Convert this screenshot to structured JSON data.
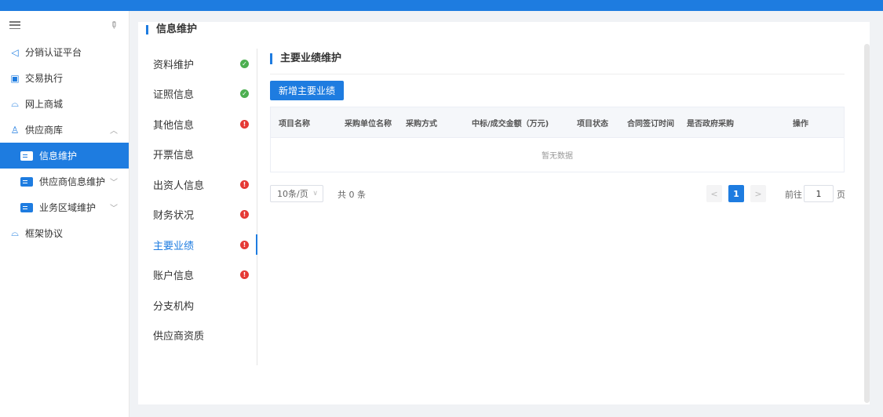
{
  "sidebar": {
    "items": [
      {
        "label": "分销认证平台",
        "icon": "speaker-icon"
      },
      {
        "label": "交易执行",
        "icon": "clipboard-icon"
      },
      {
        "label": "网上商城",
        "icon": "store-icon"
      },
      {
        "label": "供应商库",
        "icon": "user-icon"
      },
      {
        "label": "框架协议",
        "icon": "store-icon"
      }
    ],
    "subitems": [
      {
        "label": "信息维护"
      },
      {
        "label": "供应商信息维护"
      },
      {
        "label": "业务区域维护"
      }
    ]
  },
  "card": {
    "title": "信息维护"
  },
  "steps": [
    {
      "label": "资料维护",
      "status": "ok"
    },
    {
      "label": "证照信息",
      "status": "ok"
    },
    {
      "label": "其他信息",
      "status": "error"
    },
    {
      "label": "开票信息",
      "status": ""
    },
    {
      "label": "出资人信息",
      "status": "error"
    },
    {
      "label": "财务状况",
      "status": "error"
    },
    {
      "label": "主要业绩",
      "status": "error"
    },
    {
      "label": "账户信息",
      "status": "error"
    },
    {
      "label": "分支机构",
      "status": ""
    },
    {
      "label": "供应商资质",
      "status": ""
    }
  ],
  "section": {
    "title": "主要业绩维护",
    "add_button": "新增主要业绩",
    "columns": [
      "项目名称",
      "采购单位名称",
      "采购方式",
      "中标/成交金额（万元)",
      "项目状态",
      "合同签订时间",
      "是否政府采购",
      "操作"
    ],
    "empty_text": "暂无数据"
  },
  "pagination": {
    "page_size": "10条/页",
    "total": "共 0 条",
    "prev": "<",
    "current_page": "1",
    "next": ">",
    "goto_prefix": "前往",
    "goto_value": "1",
    "goto_suffix": "页"
  },
  "colors": {
    "accent": "#1e7ce0",
    "ok": "#4caf50",
    "error": "#e53935"
  }
}
